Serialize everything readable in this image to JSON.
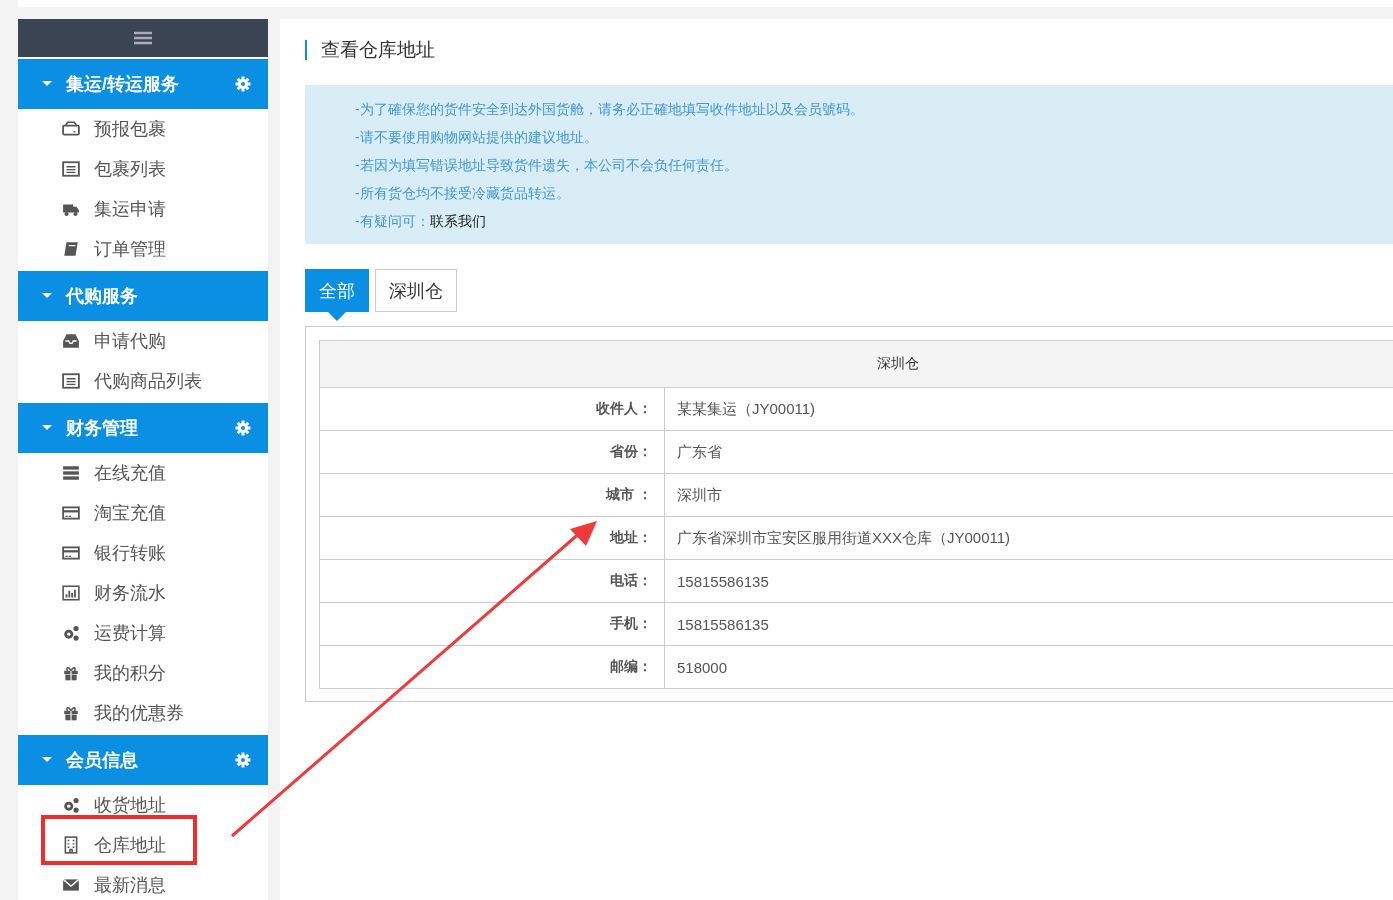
{
  "sidebar": {
    "groups": [
      {
        "title": "集运/转运服务",
        "expanded": true,
        "has_settings": true,
        "items": [
          {
            "label": "预报包裹",
            "highlighted": false
          },
          {
            "label": "包裹列表",
            "highlighted": false
          },
          {
            "label": "集运申请",
            "highlighted": false
          },
          {
            "label": "订单管理",
            "highlighted": false
          }
        ]
      },
      {
        "title": "代购服务",
        "expanded": true,
        "has_settings": false,
        "items": [
          {
            "label": "申请代购",
            "highlighted": false
          },
          {
            "label": "代购商品列表",
            "highlighted": false
          }
        ]
      },
      {
        "title": "财务管理",
        "expanded": true,
        "has_settings": true,
        "items": [
          {
            "label": "在线充值",
            "highlighted": false
          },
          {
            "label": "淘宝充值",
            "highlighted": false
          },
          {
            "label": "银行转账",
            "highlighted": false
          },
          {
            "label": "财务流水",
            "highlighted": false
          },
          {
            "label": "运费计算",
            "highlighted": false
          },
          {
            "label": "我的积分",
            "highlighted": false
          },
          {
            "label": "我的优惠券",
            "highlighted": false
          }
        ]
      },
      {
        "title": "会员信息",
        "expanded": true,
        "has_settings": true,
        "items": [
          {
            "label": "收货地址",
            "highlighted": false
          },
          {
            "label": "仓库地址",
            "highlighted": true
          },
          {
            "label": "最新消息",
            "highlighted": false
          }
        ]
      }
    ]
  },
  "page_title": "查看仓库地址",
  "notice": {
    "lines": [
      "-为了確保您的货件安全到达外国货舱，请务必正確地填写收件地址以及会员號码。",
      "-请不要使用购物网站提供的建议地址。",
      "-若因为填写错误地址导致货件遗失，本公司不会负任何责任。",
      "-所有货仓均不接受冷藏货品转运。"
    ],
    "contact_prefix": "-有疑问可：",
    "contact_link": "联系我们"
  },
  "tabs": [
    {
      "label": "全部",
      "selected": true
    },
    {
      "label": "深圳仓",
      "selected": false
    }
  ],
  "table": {
    "title": "深圳仓",
    "rows": [
      {
        "label": "收件人：",
        "value": "某某集运（JY00011)"
      },
      {
        "label": "省份：",
        "value": "广东省"
      },
      {
        "label": "城市 ：",
        "value": "深圳市"
      },
      {
        "label": "地址：",
        "value": "广东省深圳市宝安区服用街道XXX仓库（JY00011)"
      },
      {
        "label": "电话：",
        "value": "15815586135"
      },
      {
        "label": "手机：",
        "value": "15815586135"
      },
      {
        "label": "邮编：",
        "value": "518000"
      }
    ]
  },
  "annotations": [
    {
      "kind": "arrow"
    }
  ]
}
